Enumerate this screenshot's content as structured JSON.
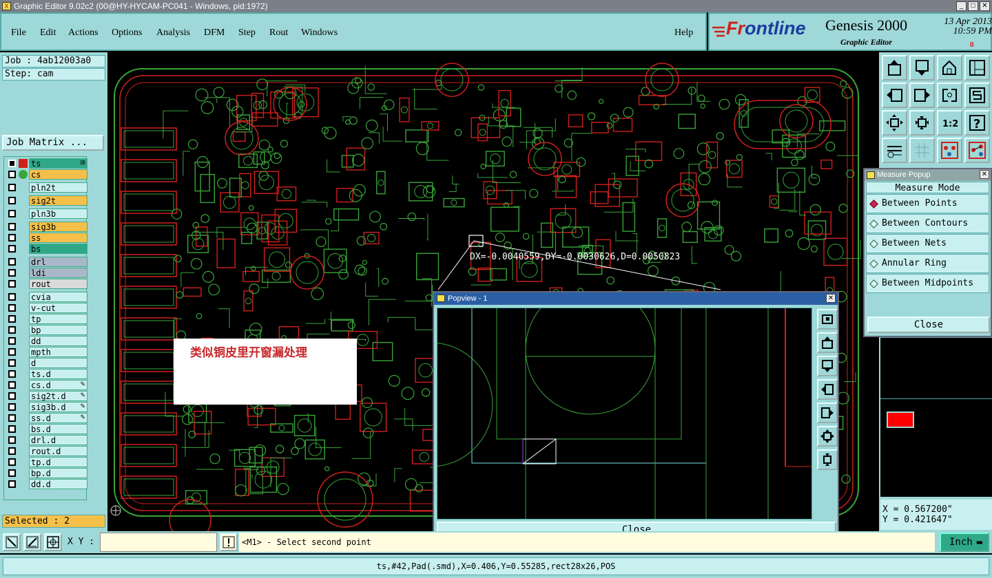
{
  "window": {
    "title": "Graphic Editor 9.02c2 (00@HY-HYCAM-PC041 - Windows, pid:1972)",
    "buttons": [
      "_",
      "□",
      "✕"
    ]
  },
  "menu": [
    "File",
    "Edit",
    "Actions",
    "Options",
    "Analysis",
    "DFM",
    "Step",
    "Rout",
    "Windows"
  ],
  "help_label": "Help",
  "brand": {
    "logo_prefix": "Fr",
    "logo_rest": "ontline",
    "product": "Genesis 2000",
    "subtitle": "Graphic Editor",
    "date": "13 Apr 2013",
    "time": "10:59 PM",
    "pause": "II"
  },
  "job": {
    "job_label": "Job : 4ab12003a0",
    "step_label": "Step: cam",
    "matrix_button": "Job Matrix ..."
  },
  "layers": [
    {
      "name": "ts",
      "style": "teal",
      "on": true,
      "mark": "⊞"
    },
    {
      "name": "cs",
      "style": "orange",
      "on": false,
      "mark": ""
    },
    {
      "name": "pln2t",
      "style": "",
      "on": false,
      "mark": ""
    },
    {
      "name": "sig2t",
      "style": "orange",
      "on": false,
      "mark": ""
    },
    {
      "name": "pln3b",
      "style": "",
      "on": false,
      "mark": ""
    },
    {
      "name": "sig3b",
      "style": "orange",
      "on": false,
      "mark": ""
    },
    {
      "name": "ss",
      "style": "orange",
      "on": false,
      "mark": ""
    },
    {
      "name": "bs",
      "style": "teal",
      "on": false,
      "mark": ""
    },
    {
      "name": "drl",
      "style": "gray",
      "on": false,
      "mark": ""
    },
    {
      "name": "ldi",
      "style": "gray",
      "on": false,
      "mark": ""
    },
    {
      "name": "rout",
      "style": "lgray",
      "on": false,
      "mark": ""
    },
    {
      "name": "cvia",
      "style": "",
      "on": false,
      "mark": ""
    },
    {
      "name": "v-cut",
      "style": "",
      "on": false,
      "mark": ""
    },
    {
      "name": "tp",
      "style": "",
      "on": false,
      "mark": ""
    },
    {
      "name": "bp",
      "style": "",
      "on": false,
      "mark": ""
    },
    {
      "name": "dd",
      "style": "",
      "on": false,
      "mark": ""
    },
    {
      "name": "mpth",
      "style": "",
      "on": false,
      "mark": ""
    },
    {
      "name": "d",
      "style": "",
      "on": false,
      "mark": ""
    },
    {
      "name": "ts.d",
      "style": "",
      "on": false,
      "mark": ""
    },
    {
      "name": "cs.d",
      "style": "",
      "on": false,
      "mark": "✎"
    },
    {
      "name": "sig2t.d",
      "style": "",
      "on": false,
      "mark": "✎"
    },
    {
      "name": "sig3b.d",
      "style": "",
      "on": false,
      "mark": "✎"
    },
    {
      "name": "ss.d",
      "style": "",
      "on": false,
      "mark": "✎"
    },
    {
      "name": "bs.d",
      "style": "",
      "on": false,
      "mark": ""
    },
    {
      "name": "drl.d",
      "style": "",
      "on": false,
      "mark": ""
    },
    {
      "name": "rout.d",
      "style": "",
      "on": false,
      "mark": ""
    },
    {
      "name": "tp.d",
      "style": "",
      "on": false,
      "mark": ""
    },
    {
      "name": "bp.d",
      "style": "",
      "on": false,
      "mark": ""
    },
    {
      "name": "dd.d",
      "style": "",
      "on": false,
      "mark": ""
    }
  ],
  "selected": "Selected : 2",
  "annotation": "类似铜皮里开窗漏处理",
  "measure_readout": "DX=-0.0040559,DY=-0.0030626,D=0.0050823",
  "measure_popup": {
    "title": "Measure Popup",
    "mode_label": "Measure Mode",
    "options": [
      "Between Points",
      "Between Contours",
      "Between Nets",
      "Annular Ring",
      "Between Midpoints"
    ],
    "selected_option": "Between Points",
    "close": "Close"
  },
  "popview": {
    "title": "Popview - 1",
    "close": "Close"
  },
  "coords": {
    "x": "X = 0.567200\"",
    "y": "Y = 0.421647\""
  },
  "command": {
    "xy_label": "X Y :",
    "xy_value": "",
    "prompt": "<M1> - Select second point",
    "unit": "Inch"
  },
  "status": "ts,#42,Pad(.smd),X=0.406,Y=0.55285,rect28x26,POS",
  "colors": {
    "panel": "#9fd8d8",
    "field": "#c9f0f0",
    "layer_orange": "#f5c04a",
    "layer_teal": "#2ea888",
    "trace_green": "#3aa53a",
    "outline_red": "#d0201c",
    "annotation_red": "#c8282a"
  }
}
